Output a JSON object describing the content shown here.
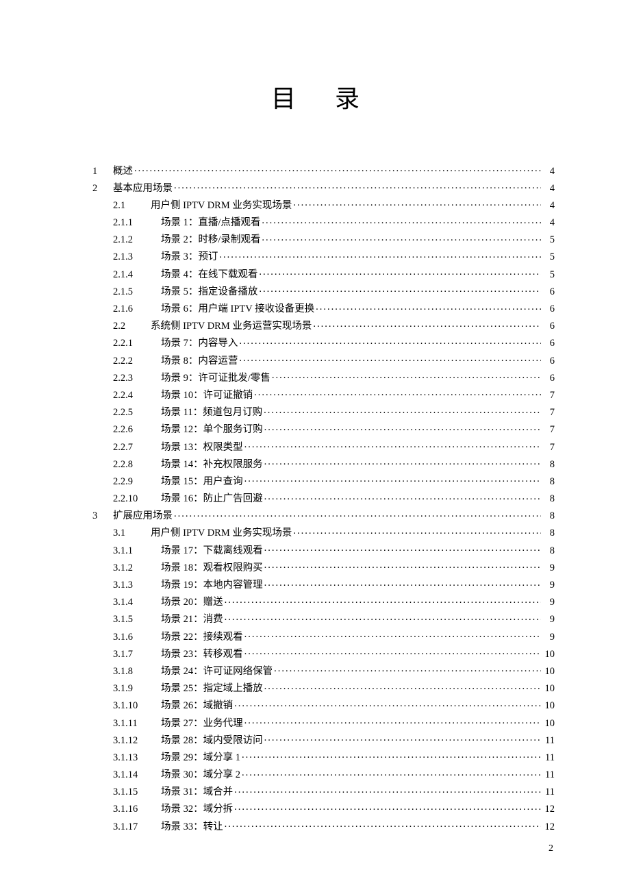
{
  "title": "目 录",
  "page_number": "2",
  "toc": [
    {
      "level": 1,
      "num": "1",
      "title": "概述",
      "page": "4"
    },
    {
      "level": 1,
      "num": "2",
      "title": "基本应用场景",
      "page": "4"
    },
    {
      "level": 2,
      "num": "2.1",
      "title": "用户侧 IPTV DRM 业务实现场景",
      "page": "4"
    },
    {
      "level": 3,
      "num": "2.1.1",
      "title": "场景 1：直播/点播观看 ",
      "page": "4"
    },
    {
      "level": 3,
      "num": "2.1.2",
      "title": "场景 2：时移/录制观看 ",
      "page": "5"
    },
    {
      "level": 3,
      "num": "2.1.3",
      "title": "场景 3：预订",
      "page": "5"
    },
    {
      "level": 3,
      "num": "2.1.4",
      "title": "场景 4：在线下载观看",
      "page": "5"
    },
    {
      "level": 3,
      "num": "2.1.5",
      "title": "场景 5：指定设备播放",
      "page": "6"
    },
    {
      "level": 3,
      "num": "2.1.6",
      "title": "场景 6：用户端 IPTV 接收设备更换",
      "page": "6"
    },
    {
      "level": 2,
      "num": "2.2",
      "title": "系统侧 IPTV DRM 业务运营实现场景",
      "page": "6"
    },
    {
      "level": 3,
      "num": "2.2.1",
      "title": "场景 7：内容导入",
      "page": "6"
    },
    {
      "level": 3,
      "num": "2.2.2",
      "title": "场景 8：内容运营",
      "page": "6"
    },
    {
      "level": 3,
      "num": "2.2.3",
      "title": "场景 9：许可证批发/零售 ",
      "page": "6"
    },
    {
      "level": 3,
      "num": "2.2.4",
      "title": "场景 10：许可证撤销",
      "page": "7"
    },
    {
      "level": 3,
      "num": "2.2.5",
      "title": "场景 11：频道包月订购",
      "page": "7"
    },
    {
      "level": 3,
      "num": "2.2.6",
      "title": "场景 12：单个服务订购",
      "page": "7"
    },
    {
      "level": 3,
      "num": "2.2.7",
      "title": "场景 13：权限类型",
      "page": "7"
    },
    {
      "level": 3,
      "num": "2.2.8",
      "title": "场景 14：补充权限服务",
      "page": "8"
    },
    {
      "level": 3,
      "num": "2.2.9",
      "title": "场景 15：用户查询",
      "page": "8"
    },
    {
      "level": 3,
      "num": "2.2.10",
      "title": "场景 16：防止广告回避",
      "page": "8"
    },
    {
      "level": 1,
      "num": "3",
      "title": "扩展应用场景",
      "page": "8"
    },
    {
      "level": 2,
      "num": "3.1",
      "title": "用户侧 IPTV DRM 业务实现场景",
      "page": "8"
    },
    {
      "level": 3,
      "num": "3.1.1",
      "title": "场景 17：下载离线观看",
      "page": "8"
    },
    {
      "level": 3,
      "num": "3.1.2",
      "title": "场景 18：观看权限购买",
      "page": "9"
    },
    {
      "level": 3,
      "num": "3.1.3",
      "title": "场景 19：本地内容管理",
      "page": "9"
    },
    {
      "level": 3,
      "num": "3.1.4",
      "title": "场景 20：赠送",
      "page": "9"
    },
    {
      "level": 3,
      "num": "3.1.5",
      "title": "场景 21：消费",
      "page": "9"
    },
    {
      "level": 3,
      "num": "3.1.6",
      "title": "场景 22：接续观看",
      "page": "9"
    },
    {
      "level": 3,
      "num": "3.1.7",
      "title": "场景 23：转移观看",
      "page": "10"
    },
    {
      "level": 3,
      "num": "3.1.8",
      "title": "场景 24：许可证网络保管",
      "page": "10"
    },
    {
      "level": 3,
      "num": "3.1.9",
      "title": "场景 25：指定域上播放",
      "page": "10"
    },
    {
      "level": 3,
      "num": "3.1.10",
      "title": "场景 26：域撤销",
      "page": "10"
    },
    {
      "level": 3,
      "num": "3.1.11",
      "title": "场景 27：业务代理",
      "page": "10"
    },
    {
      "level": 3,
      "num": "3.1.12",
      "title": "场景 28：域内受限访问",
      "page": "11"
    },
    {
      "level": 3,
      "num": "3.1.13",
      "title": "场景 29：域分享 1",
      "page": "11"
    },
    {
      "level": 3,
      "num": "3.1.14",
      "title": "场景 30：域分享 2",
      "page": "11"
    },
    {
      "level": 3,
      "num": "3.1.15",
      "title": "场景 31：域合并",
      "page": "11"
    },
    {
      "level": 3,
      "num": "3.1.16",
      "title": "场景 32：域分拆",
      "page": "12"
    },
    {
      "level": 3,
      "num": "3.1.17",
      "title": "场景 33：转让",
      "page": "12"
    }
  ]
}
